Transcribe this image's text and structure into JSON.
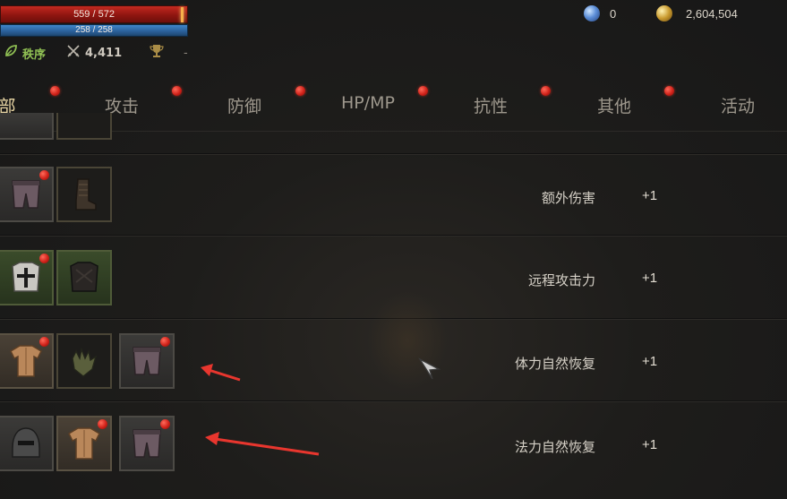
{
  "player": {
    "hp_text": "559 / 572",
    "mp_text": "258 / 258",
    "hp_fraction": 0.977,
    "mp_fraction": 1.0,
    "faction_label": "秩序",
    "combat_power": "4,411",
    "trophy_value": "-"
  },
  "currency": {
    "gems": "0",
    "gold": "2,604,504"
  },
  "tabs": [
    {
      "label": "部",
      "active": true,
      "has_alert": false
    },
    {
      "label": "攻击",
      "active": false,
      "has_alert": true
    },
    {
      "label": "防御",
      "active": false,
      "has_alert": true
    },
    {
      "label": "HP/MP",
      "active": false,
      "has_alert": true
    },
    {
      "label": "抗性",
      "active": false,
      "has_alert": true
    },
    {
      "label": "其他",
      "active": false,
      "has_alert": true
    },
    {
      "label": "活动",
      "active": false,
      "has_alert": true
    }
  ],
  "rows": [
    {
      "stat": "额外伤害",
      "value": "+1"
    },
    {
      "stat": "远程攻击力",
      "value": "+1"
    },
    {
      "stat": "体力自然恢复",
      "value": "+1"
    },
    {
      "stat": "法力自然恢复",
      "value": "+1"
    }
  ],
  "colors": {
    "hp": "#b0201a",
    "mp": "#2f6dac",
    "alert_dot": "#d0221a",
    "faction_green": "#8fbf53",
    "annotation_arrow": "#e8362e"
  }
}
